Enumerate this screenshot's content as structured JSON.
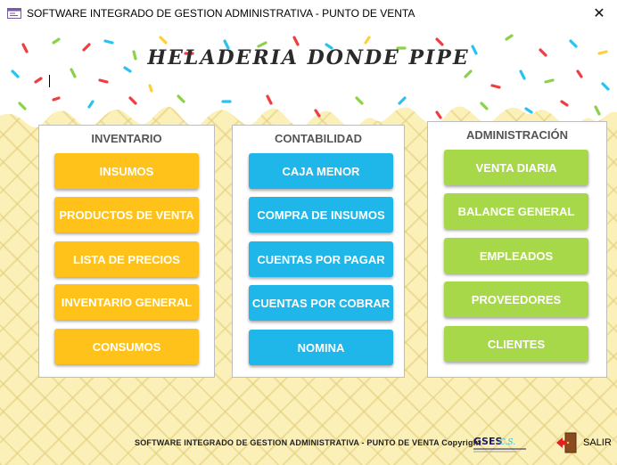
{
  "window": {
    "title": "SOFTWARE INTEGRADO DE GESTION ADMINISTRATIVA - PUNTO DE VENTA",
    "close_glyph": "✕"
  },
  "header": {
    "title": "HELADERIA DONDE PIPE"
  },
  "colors": {
    "orange": "#ffc21a",
    "blue": "#1fb6ea",
    "green": "#a7d84a",
    "waffle": "#fbf0b8"
  },
  "inventario": {
    "title": "INVENTARIO",
    "buttons": [
      "INSUMOS",
      "PRODUCTOS DE VENTA",
      "LISTA DE PRECIOS",
      "INVENTARIO GENERAL",
      "CONSUMOS"
    ]
  },
  "contabilidad": {
    "title": "CONTABILIDAD",
    "buttons": [
      "CAJA MENOR",
      "COMPRA DE INSUMOS",
      "CUENTAS POR PAGAR",
      "CUENTAS POR COBRAR",
      "NOMINA"
    ]
  },
  "administracion": {
    "title": "ADMINISTRACIÓN",
    "buttons": [
      "VENTA DIARIA",
      "BALANCE GENERAL",
      "EMPLEADOS",
      "PROVEEDORES",
      "CLIENTES"
    ]
  },
  "footer": {
    "text": "SOFTWARE INTEGRADO DE GESTION ADMINISTRATIVA - PUNTO DE VENTA Copyright",
    "exit_label": "SALIR"
  }
}
